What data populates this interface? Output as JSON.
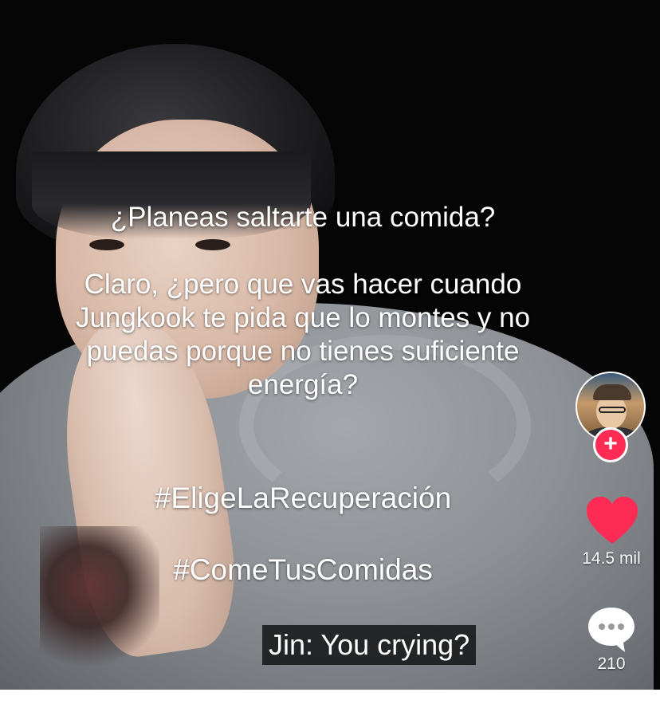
{
  "caption": {
    "question": "¿Planeas saltarte una comida?",
    "body": "Claro, ¿pero que vas hacer cuando Jungkook te pida que lo montes y no puedas porque no tienes suficiente energía?",
    "hashtags": [
      "#EligeLaRecuperación",
      "#ComeTusComidas"
    ]
  },
  "video_subtitle": "Jin: You crying?",
  "actions": {
    "likes": "14.5 mil",
    "comments": "210"
  },
  "icons": {
    "follow": "plus-icon",
    "like": "heart-icon",
    "comment": "comment-bubble-icon"
  },
  "colors": {
    "like_red": "#fe2c55",
    "follow_red": "#fe2c55",
    "text": "#ffffff"
  }
}
